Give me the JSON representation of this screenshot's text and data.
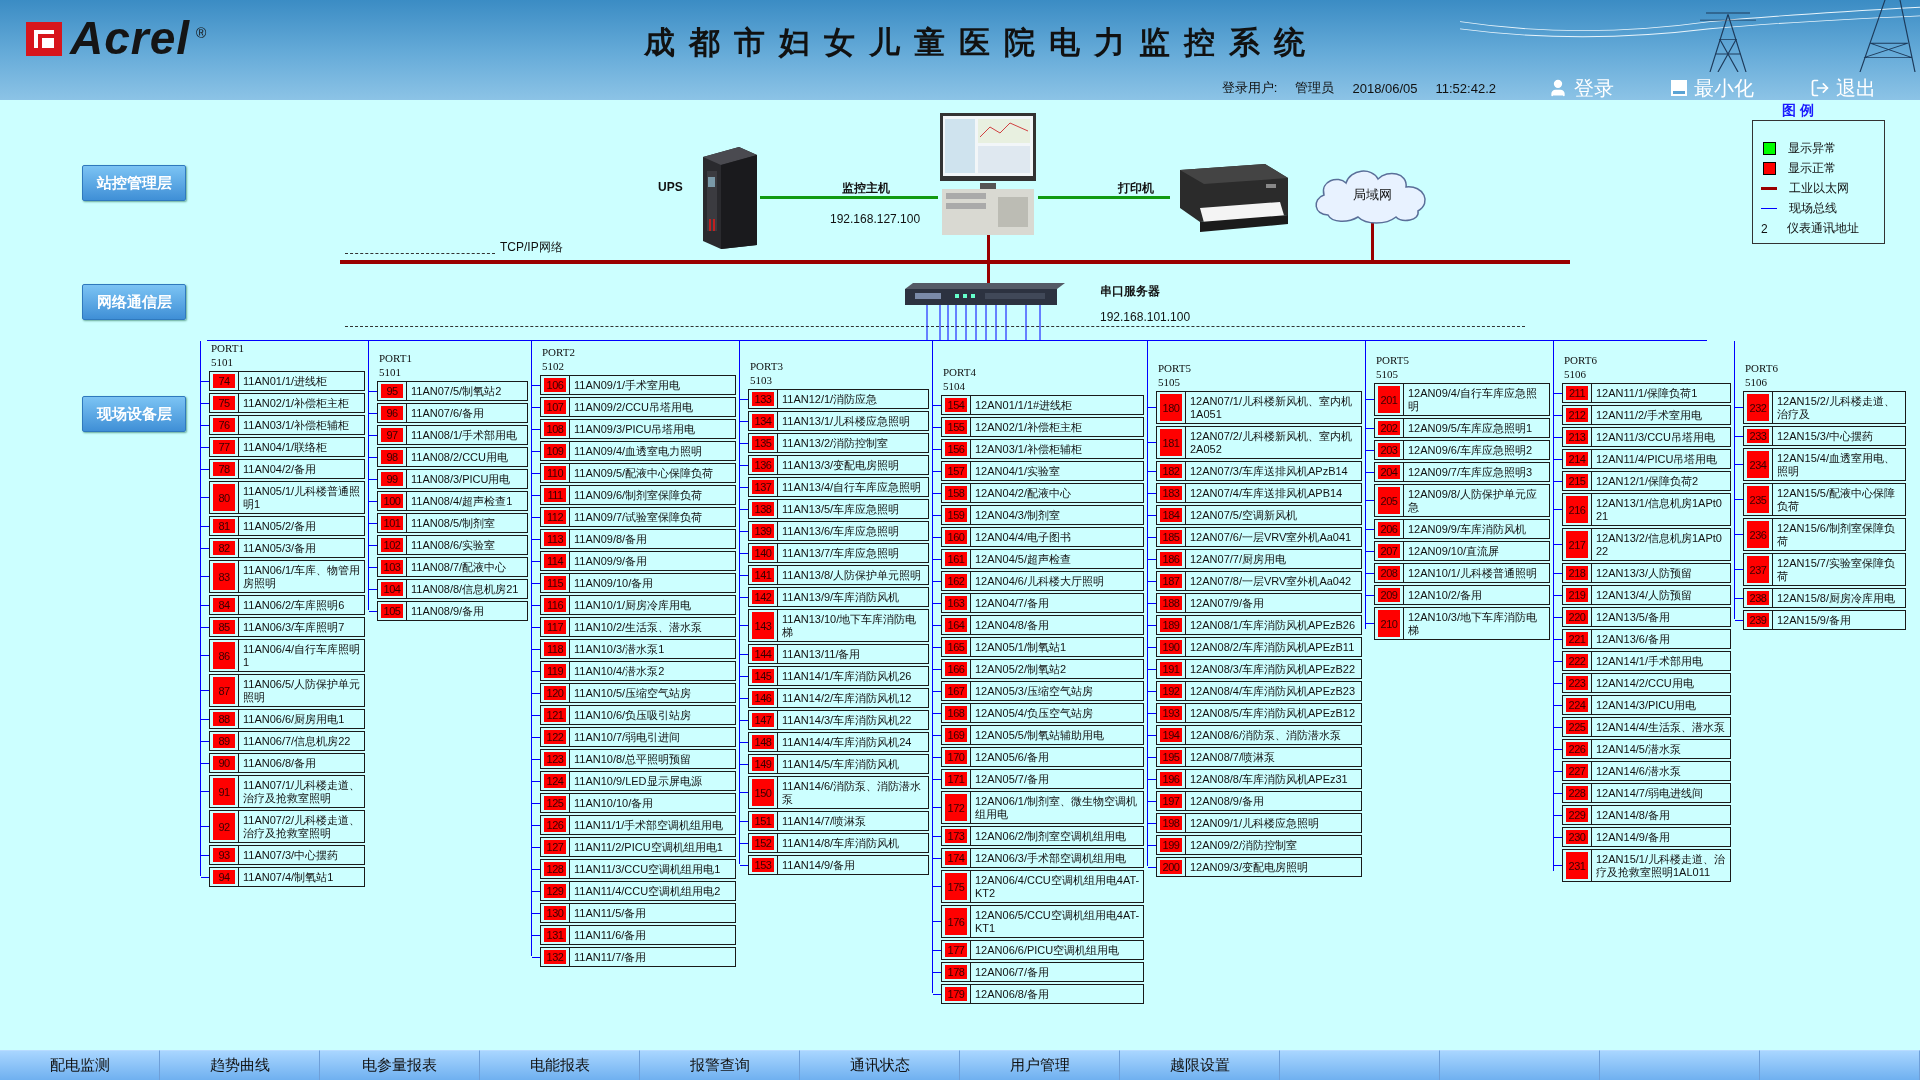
{
  "header": {
    "logo": "Acrel",
    "logo_mark": "®",
    "title": "成都市妇女儿童医院电力监控系统",
    "user_label": "登录用户:",
    "user": "管理员",
    "date": "2018/06/05",
    "time": "11:52:42.2",
    "buttons": [
      {
        "label": "登录",
        "kind": "login"
      },
      {
        "label": "最小化",
        "kind": "minimize"
      },
      {
        "label": "退出",
        "kind": "exit"
      }
    ]
  },
  "layers": [
    "站控管理层",
    "网络通信层",
    "现场设备层"
  ],
  "network": {
    "ups_label": "UPS",
    "host_label": "监控主机",
    "host_ip": "192.168.127.100",
    "printer_label": "打印机",
    "lan_label": "局域网",
    "tcpip_label": "TCP/IP网络",
    "server_label": "串口服务器",
    "server_ip": "192.168.101.100"
  },
  "legend": {
    "title": "图 例",
    "items": [
      {
        "kind": "square",
        "color": "#00ff00",
        "label": "显示异常"
      },
      {
        "kind": "square",
        "color": "#ff0000",
        "label": "显示正常"
      },
      {
        "kind": "line",
        "color": "#990000",
        "label": "工业以太网"
      },
      {
        "kind": "line",
        "color": "#0000ff",
        "label": "现场总线"
      },
      {
        "kind": "address",
        "symbol": "2",
        "label": "仪表通讯地址"
      }
    ]
  },
  "ports": [
    {
      "name": "PORT1",
      "number": "5101",
      "devices": [
        {
          "addr": "74",
          "name": "11AN01/1/进线柜",
          "color": "#ff0000"
        },
        {
          "addr": "75",
          "name": "11AN02/1/补偿柜主柜",
          "color": "#ff0000"
        },
        {
          "addr": "76",
          "name": "11AN03/1/补偿柜辅柜",
          "color": "#ff0000"
        },
        {
          "addr": "77",
          "name": "11AN04/1/联络柜",
          "color": "#ff0000"
        },
        {
          "addr": "78",
          "name": "11AN04/2/备用",
          "color": "#ff0000"
        },
        {
          "addr": "80",
          "name": "11AN05/1/儿科楼普通照明1",
          "color": "#ff0000"
        },
        {
          "addr": "81",
          "name": "11AN05/2/备用",
          "color": "#ff0000"
        },
        {
          "addr": "82",
          "name": "11AN05/3/备用",
          "color": "#ff0000"
        },
        {
          "addr": "83",
          "name": "11AN06/1/车库、物管用房照明",
          "color": "#ff0000"
        },
        {
          "addr": "84",
          "name": "11AN06/2/车库照明6",
          "color": "#ff0000"
        },
        {
          "addr": "85",
          "name": "11AN06/3/车库照明7",
          "color": "#ff0000"
        },
        {
          "addr": "86",
          "name": "11AN06/4/自行车库照明1",
          "color": "#ff0000"
        },
        {
          "addr": "87",
          "name": "11AN06/5/人防保护单元照明",
          "color": "#ff0000"
        },
        {
          "addr": "88",
          "name": "11AN06/6/厨房用电1",
          "color": "#ff0000"
        },
        {
          "addr": "89",
          "name": "11AN06/7/信息机房22",
          "color": "#ff0000"
        },
        {
          "addr": "90",
          "name": "11AN06/8/备用",
          "color": "#ff0000"
        },
        {
          "addr": "91",
          "name": "11AN07/1/儿科楼走道、治疗及抢救室照明",
          "color": "#ff0000"
        },
        {
          "addr": "92",
          "name": "11AN07/2/儿科楼走道、治疗及抢救室照明",
          "color": "#ff0000"
        },
        {
          "addr": "93",
          "name": "11AN07/3/中心摆药",
          "color": "#ff0000"
        },
        {
          "addr": "94",
          "name": "11AN07/4/制氧站1",
          "color": "#ff0000"
        }
      ]
    },
    {
      "name": "PORT1",
      "number": "5101",
      "devices": [
        {
          "addr": "95",
          "name": "11AN07/5/制氧站2",
          "color": "#ff0000"
        },
        {
          "addr": "96",
          "name": "11AN07/6/备用",
          "color": "#ff0000"
        },
        {
          "addr": "97",
          "name": "11AN08/1/手术部用电",
          "color": "#ff0000"
        },
        {
          "addr": "98",
          "name": "11AN08/2/CCU用电",
          "color": "#ff0000"
        },
        {
          "addr": "99",
          "name": "11AN08/3/PICU用电",
          "color": "#ff0000"
        },
        {
          "addr": "100",
          "name": "11AN08/4/超声检查1",
          "color": "#ff0000"
        },
        {
          "addr": "101",
          "name": "11AN08/5/制剂室",
          "color": "#ff0000"
        },
        {
          "addr": "102",
          "name": "11AN08/6/实验室",
          "color": "#ff0000"
        },
        {
          "addr": "103",
          "name": "11AN08/7/配液中心",
          "color": "#ff0000"
        },
        {
          "addr": "104",
          "name": "11AN08/8/信息机房21",
          "color": "#ff0000"
        },
        {
          "addr": "105",
          "name": "11AN08/9/备用",
          "color": "#ff0000"
        }
      ]
    },
    {
      "name": "PORT2",
      "number": "5102",
      "devices": [
        {
          "addr": "106",
          "name": "11AN09/1/手术室用电",
          "color": "#ff0000"
        },
        {
          "addr": "107",
          "name": "11AN09/2/CCU吊塔用电",
          "color": "#ff0000"
        },
        {
          "addr": "108",
          "name": "11AN09/3/PICU吊塔用电",
          "color": "#ff0000"
        },
        {
          "addr": "109",
          "name": "11AN09/4/血透室电力照明",
          "color": "#ff0000"
        },
        {
          "addr": "110",
          "name": "11AN09/5/配液中心保障负荷",
          "color": "#ff0000"
        },
        {
          "addr": "111",
          "name": "11AN09/6/制剂室保障负荷",
          "color": "#ff0000"
        },
        {
          "addr": "112",
          "name": "11AN09/7/试验室保障负荷",
          "color": "#ff0000"
        },
        {
          "addr": "113",
          "name": "11AN09/8/备用",
          "color": "#ff0000"
        },
        {
          "addr": "114",
          "name": "11AN09/9/备用",
          "color": "#ff0000"
        },
        {
          "addr": "115",
          "name": "11AN09/10/备用",
          "color": "#ff0000"
        },
        {
          "addr": "116",
          "name": "11AN10/1/厨房冷库用电",
          "color": "#ff0000"
        },
        {
          "addr": "117",
          "name": "11AN10/2/生活泵、潜水泵",
          "color": "#ff0000"
        },
        {
          "addr": "118",
          "name": "11AN10/3/潜水泵1",
          "color": "#ff0000"
        },
        {
          "addr": "119",
          "name": "11AN10/4/潜水泵2",
          "color": "#ff0000"
        },
        {
          "addr": "120",
          "name": "11AN10/5/压缩空气站房",
          "color": "#ff0000"
        },
        {
          "addr": "121",
          "name": "11AN10/6/负压吸引站房",
          "color": "#ff0000"
        },
        {
          "addr": "122",
          "name": "11AN10/7/弱电引进间",
          "color": "#ff0000"
        },
        {
          "addr": "123",
          "name": "11AN10/8/总平照明预留",
          "color": "#ff0000"
        },
        {
          "addr": "124",
          "name": "11AN10/9/LED显示屏电源",
          "color": "#ff0000"
        },
        {
          "addr": "125",
          "name": "11AN10/10/备用",
          "color": "#ff0000"
        },
        {
          "addr": "126",
          "name": "11AN11/1/手术部空调机组用电",
          "color": "#ff0000"
        },
        {
          "addr": "127",
          "name": "11AN11/2/PICU空调机组用电1",
          "color": "#ff0000"
        },
        {
          "addr": "128",
          "name": "11AN11/3/CCU空调机组用电1",
          "color": "#ff0000"
        },
        {
          "addr": "129",
          "name": "11AN11/4/CCU空调机组用电2",
          "color": "#ff0000"
        },
        {
          "addr": "130",
          "name": "11AN11/5/备用",
          "color": "#ff0000"
        },
        {
          "addr": "131",
          "name": "11AN11/6/备用",
          "color": "#ff0000"
        },
        {
          "addr": "132",
          "name": "11AN11/7/备用",
          "color": "#ff0000"
        }
      ]
    },
    {
      "name": "PORT3",
      "number": "5103",
      "devices": [
        {
          "addr": "133",
          "name": "11AN12/1/消防应急",
          "color": "#ff0000"
        },
        {
          "addr": "134",
          "name": "11AN13/1/儿科楼应急照明",
          "color": "#ff0000"
        },
        {
          "addr": "135",
          "name": "11AN13/2/消防控制室",
          "color": "#ff0000"
        },
        {
          "addr": "136",
          "name": "11AN13/3/变配电房照明",
          "color": "#ff0000"
        },
        {
          "addr": "137",
          "name": "11AN13/4/自行车库应急照明",
          "color": "#ff0000"
        },
        {
          "addr": "138",
          "name": "11AN13/5/车库应急照明",
          "color": "#ff0000"
        },
        {
          "addr": "139",
          "name": "11AN13/6/车库应急照明",
          "color": "#ff0000"
        },
        {
          "addr": "140",
          "name": "11AN13/7/车库应急照明",
          "color": "#ff0000"
        },
        {
          "addr": "141",
          "name": "11AN13/8/人防保护单元照明",
          "color": "#ff0000"
        },
        {
          "addr": "142",
          "name": "11AN13/9/车库消防风机",
          "color": "#ff0000"
        },
        {
          "addr": "143",
          "name": "11AN13/10/地下车库消防电梯",
          "color": "#ff0000"
        },
        {
          "addr": "144",
          "name": "11AN13/11/备用",
          "color": "#ff0000"
        },
        {
          "addr": "145",
          "name": "11AN14/1/车库消防风机26",
          "color": "#ff0000"
        },
        {
          "addr": "146",
          "name": "11AN14/2/车库消防风机12",
          "color": "#ff0000"
        },
        {
          "addr": "147",
          "name": "11AN14/3/车库消防风机22",
          "color": "#ff0000"
        },
        {
          "addr": "148",
          "name": "11AN14/4/车库消防风机24",
          "color": "#ff0000"
        },
        {
          "addr": "149",
          "name": "11AN14/5/车库消防风机",
          "color": "#ff0000"
        },
        {
          "addr": "150",
          "name": "11AN14/6/消防泵、消防潜水泵",
          "color": "#ff0000"
        },
        {
          "addr": "151",
          "name": "11AN14/7/喷淋泵",
          "color": "#ff0000"
        },
        {
          "addr": "152",
          "name": "11AN14/8/车库消防风机",
          "color": "#ff0000"
        },
        {
          "addr": "153",
          "name": "11AN14/9/备用",
          "color": "#ff0000"
        }
      ]
    },
    {
      "name": "PORT4",
      "number": "5104",
      "devices": [
        {
          "addr": "154",
          "name": "12AN01/1/1#进线柜",
          "color": "#ff0000"
        },
        {
          "addr": "155",
          "name": "12AN02/1/补偿柜主柜",
          "color": "#ff0000"
        },
        {
          "addr": "156",
          "name": "12AN03/1/补偿柜辅柜",
          "color": "#ff0000"
        },
        {
          "addr": "157",
          "name": "12AN04/1/实验室",
          "color": "#ff0000"
        },
        {
          "addr": "158",
          "name": "12AN04/2/配液中心",
          "color": "#ff0000"
        },
        {
          "addr": "159",
          "name": "12AN04/3/制剂室",
          "color": "#ff0000"
        },
        {
          "addr": "160",
          "name": "12AN04/4/电子图书",
          "color": "#ff0000"
        },
        {
          "addr": "161",
          "name": "12AN04/5/超声检查",
          "color": "#ff0000"
        },
        {
          "addr": "162",
          "name": "12AN04/6/儿科楼大厅照明",
          "color": "#ff0000"
        },
        {
          "addr": "163",
          "name": "12AN04/7/备用",
          "color": "#ff0000"
        },
        {
          "addr": "164",
          "name": "12AN04/8/备用",
          "color": "#ff0000"
        },
        {
          "addr": "165",
          "name": "12AN05/1/制氧站1",
          "color": "#ff0000"
        },
        {
          "addr": "166",
          "name": "12AN05/2/制氧站2",
          "color": "#ff0000"
        },
        {
          "addr": "167",
          "name": "12AN05/3/压缩空气站房",
          "color": "#ff0000"
        },
        {
          "addr": "168",
          "name": "12AN05/4/负压空气站房",
          "color": "#ff0000"
        },
        {
          "addr": "169",
          "name": "12AN05/5/制氧站辅助用电",
          "color": "#ff0000"
        },
        {
          "addr": "170",
          "name": "12AN05/6/备用",
          "color": "#ff0000"
        },
        {
          "addr": "171",
          "name": "12AN05/7/备用",
          "color": "#ff0000"
        },
        {
          "addr": "172",
          "name": "12AN06/1/制剂室、微生物空调机组用电",
          "color": "#ff0000"
        },
        {
          "addr": "173",
          "name": "12AN06/2/制剂室空调机组用电",
          "color": "#ff0000"
        },
        {
          "addr": "174",
          "name": "12AN06/3/手术部空调机组用电",
          "color": "#ff0000"
        },
        {
          "addr": "175",
          "name": "12AN06/4/CCU空调机组用电4AT-KT2",
          "color": "#ff0000"
        },
        {
          "addr": "176",
          "name": "12AN06/5/CCU空调机组用电4AT-KT1",
          "color": "#ff0000"
        },
        {
          "addr": "177",
          "name": "12AN06/6/PICU空调机组用电",
          "color": "#ff0000"
        },
        {
          "addr": "178",
          "name": "12AN06/7/备用",
          "color": "#ff0000"
        },
        {
          "addr": "179",
          "name": "12AN06/8/备用",
          "color": "#ff0000"
        }
      ]
    },
    {
      "name": "PORT5",
      "number": "5105",
      "devices": [
        {
          "addr": "180",
          "name": "12AN07/1/儿科楼新风机、室内机1A051",
          "color": "#ff0000"
        },
        {
          "addr": "181",
          "name": "12AN07/2/儿科楼新风机、室内机2A052",
          "color": "#ff0000"
        },
        {
          "addr": "182",
          "name": "12AN07/3/车库送排风机APzB14",
          "color": "#ff0000"
        },
        {
          "addr": "183",
          "name": "12AN07/4/车库送排风机APB14",
          "color": "#ff0000"
        },
        {
          "addr": "184",
          "name": "12AN07/5/空调新风机",
          "color": "#ff0000"
        },
        {
          "addr": "185",
          "name": "12AN07/6/一层VRV室外机Aa041",
          "color": "#ff0000"
        },
        {
          "addr": "186",
          "name": "12AN07/7/厨房用电",
          "color": "#ff0000"
        },
        {
          "addr": "187",
          "name": "12AN07/8/一层VRV室外机Aa042",
          "color": "#ff0000"
        },
        {
          "addr": "188",
          "name": "12AN07/9/备用",
          "color": "#ff0000"
        },
        {
          "addr": "189",
          "name": "12AN08/1/车库消防风机APEzB26",
          "color": "#ff0000"
        },
        {
          "addr": "190",
          "name": "12AN08/2/车库消防风机APEzB11",
          "color": "#ff0000"
        },
        {
          "addr": "191",
          "name": "12AN08/3/车库消防风机APEzB22",
          "color": "#ff0000"
        },
        {
          "addr": "192",
          "name": "12AN08/4/车库消防风机APEzB23",
          "color": "#ff0000"
        },
        {
          "addr": "193",
          "name": "12AN08/5/车库消防风机APEzB12",
          "color": "#ff0000"
        },
        {
          "addr": "194",
          "name": "12AN08/6/消防泵、消防潜水泵",
          "color": "#ff0000"
        },
        {
          "addr": "195",
          "name": "12AN08/7/喷淋泵",
          "color": "#ff0000"
        },
        {
          "addr": "196",
          "name": "12AN08/8/车库消防风机APEz31",
          "color": "#ff0000"
        },
        {
          "addr": "197",
          "name": "12AN08/9/备用",
          "color": "#ff0000"
        },
        {
          "addr": "198",
          "name": "12AN09/1/儿科楼应急照明",
          "color": "#ff0000"
        },
        {
          "addr": "199",
          "name": "12AN09/2/消防控制室",
          "color": "#ff0000"
        },
        {
          "addr": "200",
          "name": "12AN09/3/变配电房照明",
          "color": "#ff0000"
        }
      ]
    },
    {
      "name": "PORT5",
      "number": "5105",
      "devices": [
        {
          "addr": "201",
          "name": "12AN09/4/自行车库应急照明",
          "color": "#ff0000"
        },
        {
          "addr": "202",
          "name": "12AN09/5/车库应急照明1",
          "color": "#ff0000"
        },
        {
          "addr": "203",
          "name": "12AN09/6/车库应急照明2",
          "color": "#ff0000"
        },
        {
          "addr": "204",
          "name": "12AN09/7/车库应急照明3",
          "color": "#ff0000"
        },
        {
          "addr": "205",
          "name": "12AN09/8/人防保护单元应急",
          "color": "#ff0000"
        },
        {
          "addr": "206",
          "name": "12AN09/9/车库消防风机",
          "color": "#ff0000"
        },
        {
          "addr": "207",
          "name": "12AN09/10/直流屏",
          "color": "#ff0000"
        },
        {
          "addr": "208",
          "name": "12AN10/1/儿科楼普通照明",
          "color": "#ff0000"
        },
        {
          "addr": "209",
          "name": "12AN10/2/备用",
          "color": "#ff0000"
        },
        {
          "addr": "210",
          "name": "12AN10/3/地下车库消防电梯",
          "color": "#ff0000"
        }
      ]
    },
    {
      "name": "PORT6",
      "number": "5106",
      "devices": [
        {
          "addr": "211",
          "name": "12AN11/1/保障负荷1",
          "color": "#ff0000"
        },
        {
          "addr": "212",
          "name": "12AN11/2/手术室用电",
          "color": "#ff0000"
        },
        {
          "addr": "213",
          "name": "12AN11/3/CCU吊塔用电",
          "color": "#ff0000"
        },
        {
          "addr": "214",
          "name": "12AN11/4/PICU吊塔用电",
          "color": "#ff0000"
        },
        {
          "addr": "215",
          "name": "12AN12/1/保障负荷2",
          "color": "#ff0000"
        },
        {
          "addr": "216",
          "name": "12AN13/1/信息机房1APt021",
          "color": "#ff0000"
        },
        {
          "addr": "217",
          "name": "12AN13/2/信息机房1APt022",
          "color": "#ff0000"
        },
        {
          "addr": "218",
          "name": "12AN13/3/人防预留",
          "color": "#ff0000"
        },
        {
          "addr": "219",
          "name": "12AN13/4/人防预留",
          "color": "#ff0000"
        },
        {
          "addr": "220",
          "name": "12AN13/5/备用",
          "color": "#ff0000"
        },
        {
          "addr": "221",
          "name": "12AN13/6/备用",
          "color": "#ff0000"
        },
        {
          "addr": "222",
          "name": "12AN14/1/手术部用电",
          "color": "#ff0000"
        },
        {
          "addr": "223",
          "name": "12AN14/2/CCU用电",
          "color": "#ff0000"
        },
        {
          "addr": "224",
          "name": "12AN14/3/PICU用电",
          "color": "#ff0000"
        },
        {
          "addr": "225",
          "name": "12AN14/4/生活泵、潜水泵",
          "color": "#ff0000"
        },
        {
          "addr": "226",
          "name": "12AN14/5/潜水泵",
          "color": "#ff0000"
        },
        {
          "addr": "227",
          "name": "12AN14/6/潜水泵",
          "color": "#ff0000"
        },
        {
          "addr": "228",
          "name": "12AN14/7/弱电进线间",
          "color": "#ff0000"
        },
        {
          "addr": "229",
          "name": "12AN14/8/备用",
          "color": "#ff0000"
        },
        {
          "addr": "230",
          "name": "12AN14/9/备用",
          "color": "#ff0000"
        },
        {
          "addr": "231",
          "name": "12AN15/1/儿科楼走道、治疗及抢救室照明1AL011",
          "color": "#ff0000"
        }
      ]
    },
    {
      "name": "PORT6",
      "number": "5106",
      "devices": [
        {
          "addr": "232",
          "name": "12AN15/2/儿科楼走道、治疗及",
          "color": "#ff0000"
        },
        {
          "addr": "233",
          "name": "12AN15/3/中心摆药",
          "color": "#ff0000"
        },
        {
          "addr": "234",
          "name": "12AN15/4/血透室用电、照明",
          "color": "#ff0000"
        },
        {
          "addr": "235",
          "name": "12AN15/5/配液中心保障负荷",
          "color": "#ff0000"
        },
        {
          "addr": "236",
          "name": "12AN15/6/制剂室保障负荷",
          "color": "#ff0000"
        },
        {
          "addr": "237",
          "name": "12AN15/7/实验室保障负荷",
          "color": "#ff0000"
        },
        {
          "addr": "238",
          "name": "12AN15/8/厨房冷库用电",
          "color": "#ff0000"
        },
        {
          "addr": "239",
          "name": "12AN15/9/备用",
          "color": "#ff0000"
        }
      ]
    }
  ],
  "menu": [
    "配电监测",
    "趋势曲线",
    "电参量报表",
    "电能报表",
    "报警查询",
    "通讯状态",
    "用户管理",
    "越限设置"
  ]
}
